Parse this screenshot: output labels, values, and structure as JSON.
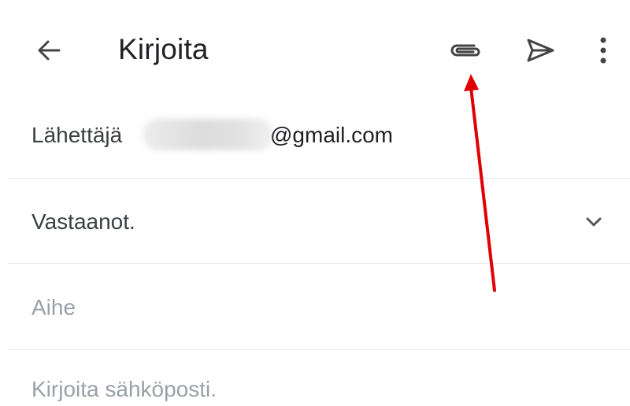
{
  "header": {
    "title": "Kirjoita",
    "icons": {
      "back": "arrow-back-icon",
      "attach": "paperclip-icon",
      "send": "send-icon",
      "more": "more-vert-icon"
    }
  },
  "form": {
    "from_label": "Lähettäjä",
    "from_email_domain": "@gmail.com",
    "to_label": "Vastaanot.",
    "subject_placeholder": "Aihe",
    "body_placeholder": "Kirjoita sähköposti."
  },
  "colors": {
    "text": "#202124",
    "placeholder": "#9aa0a6",
    "divider": "#e6e6e6",
    "annotation_arrow": "#e00000"
  }
}
